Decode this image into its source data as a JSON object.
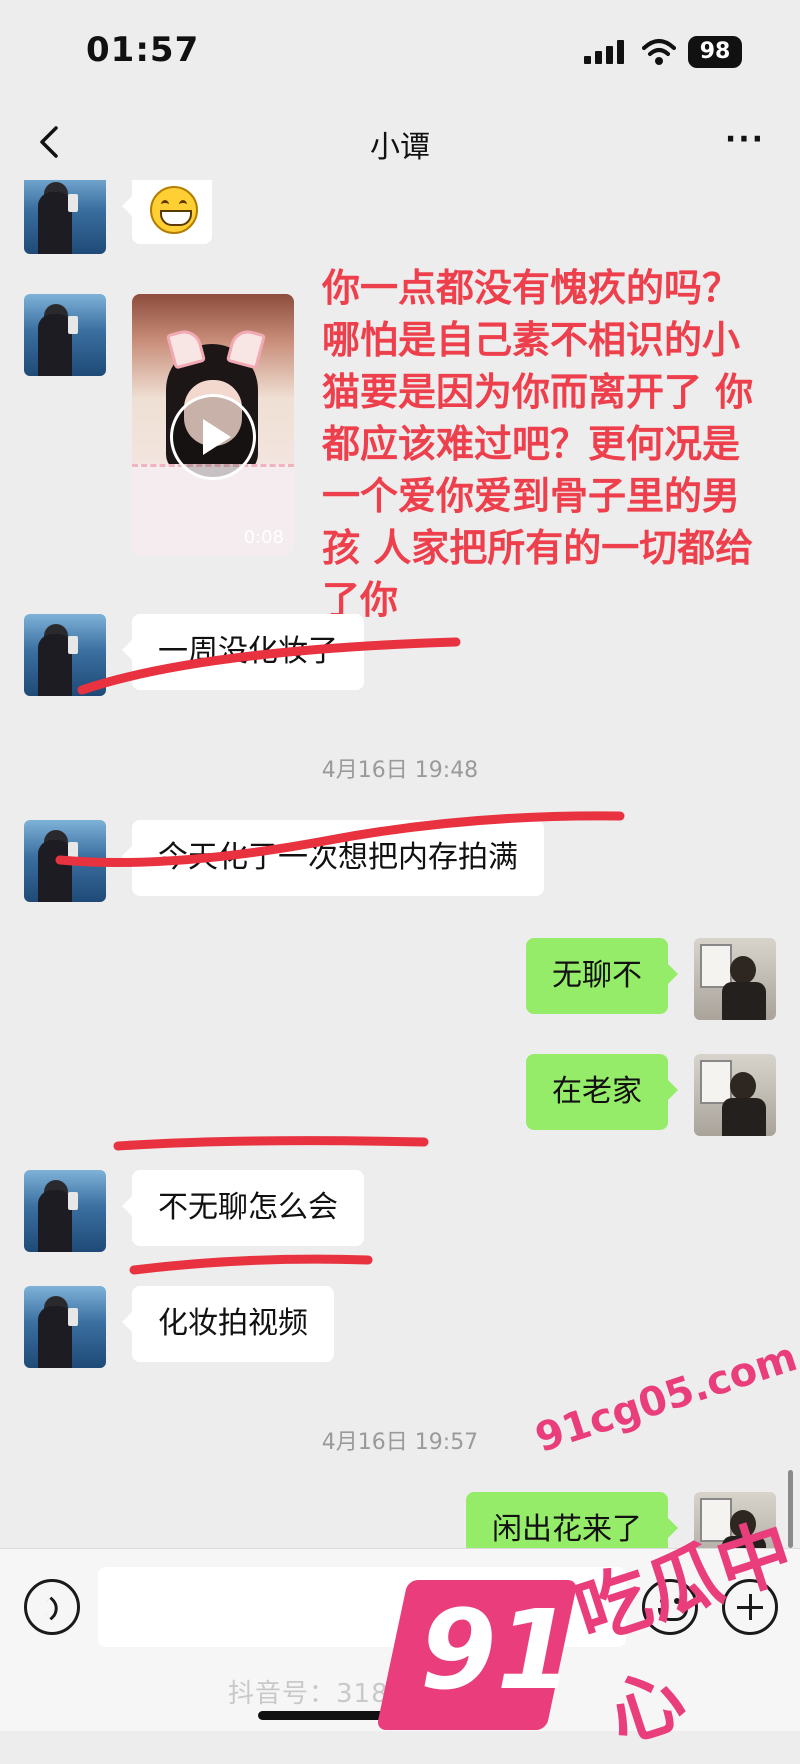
{
  "status_bar": {
    "time": "01:57",
    "battery": "98"
  },
  "header": {
    "title": "小谭",
    "more": "···"
  },
  "messages": {
    "video_duration": "0:08",
    "m1": "一周没化妆了",
    "ts1": "4月16日 19:48",
    "m2": "今天化了一次想把内存拍满",
    "m3": "无聊不",
    "m4": "在老家",
    "m5": "不无聊怎么会",
    "m6": "化妆拍视频",
    "ts2": "4月16日 19:57",
    "m7": "闲出花来了"
  },
  "overlay_caption": "你一点都没有愧疚的吗？哪怕是自己素不相识的小猫要是因为你而离开了 你都应该难过吧？更何况是一个爱你爱到骨子里的男孩 人家把所有的一切都给了你",
  "footer": {
    "douyin_id": "抖音号：31801288787"
  },
  "watermark": {
    "number": "91",
    "url": "91cg05.com",
    "name": "吃瓜中心"
  },
  "icons": [
    "back-icon",
    "more-icon",
    "signal-icon",
    "wifi-icon",
    "play-icon",
    "voice-icon",
    "emoji-icon",
    "plus-icon"
  ],
  "colors": {
    "background": "#ededed",
    "right_bubble": "#95ec69",
    "caption": "#ee3f4c",
    "watermark": "#ea3d7c"
  }
}
